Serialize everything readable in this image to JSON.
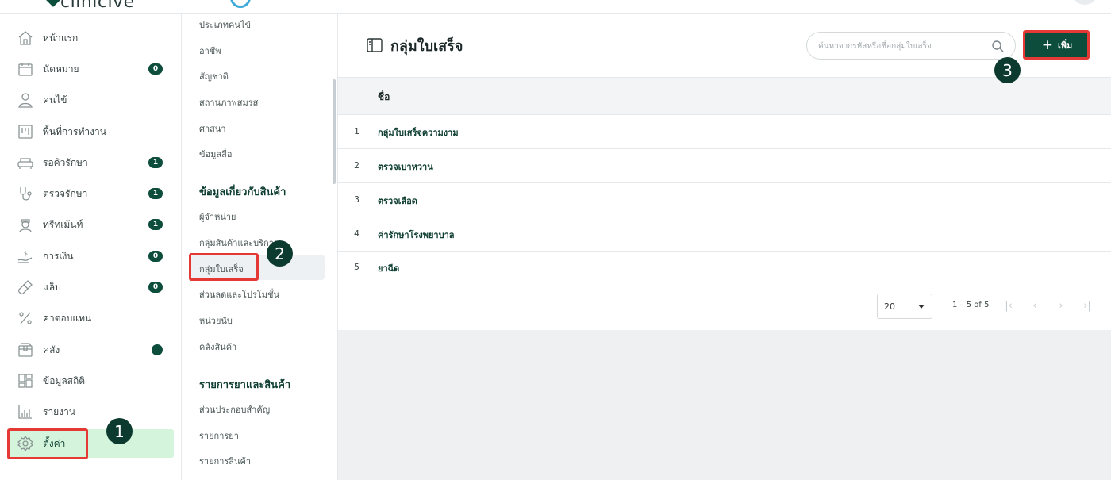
{
  "app": {
    "logo_text": "clinicive"
  },
  "sidebar": {
    "items": [
      {
        "label": "หน้าแรก",
        "icon": "home-icon"
      },
      {
        "label": "นัดหมาย",
        "icon": "calendar-icon",
        "badge": "0"
      },
      {
        "label": "คนไข้",
        "icon": "user-icon"
      },
      {
        "label": "พื้นที่การทำงาน",
        "icon": "board-icon"
      },
      {
        "label": "รอคิวรักษา",
        "icon": "sofa-icon",
        "badge": "1"
      },
      {
        "label": "ตรวจรักษา",
        "icon": "stethoscope-icon",
        "badge": "1"
      },
      {
        "label": "ทรีทเม้นท์",
        "icon": "nurse-icon",
        "badge": "1"
      },
      {
        "label": "การเงิน",
        "icon": "money-hand-icon",
        "badge": "0"
      },
      {
        "label": "แล็บ",
        "icon": "test-tube-icon",
        "badge": "0"
      },
      {
        "label": "ค่าตอบแทน",
        "icon": "percent-icon"
      },
      {
        "label": "คลัง",
        "icon": "box-icon",
        "dot": true
      },
      {
        "label": "ข้อมูลสถิติ",
        "icon": "dashboard-icon"
      },
      {
        "label": "รายงาน",
        "icon": "bar-chart-icon"
      },
      {
        "label": "ตั้งค่า",
        "icon": "gear-icon",
        "active": true
      }
    ]
  },
  "submenu": {
    "items_top": [
      "ประเภทคนไข้",
      "อาชีพ",
      "สัญชาติ",
      "สถานภาพสมรส",
      "ศาสนา",
      "ข้อมูลสื่อ"
    ],
    "section_product": "ข้อมูลเกี่ยวกับสินค้า",
    "items_product": [
      "ผู้จำหน่าย",
      "กลุ่มสินค้าและบริการ",
      "กลุ่มใบเสร็จ",
      "ส่วนลดและโปรโมชั่น",
      "หน่วยนับ",
      "คลังสินค้า"
    ],
    "section_drug": "รายการยาและสินค้า",
    "items_drug": [
      "ส่วนประกอบสำคัญ",
      "รายการยา",
      "รายการสินค้า"
    ],
    "active": "กลุ่มใบเสร็จ"
  },
  "main": {
    "title": "กลุ่มใบเสร็จ",
    "search_placeholder": "ค้นหาจากรหัสหรือชื่อกลุ่มใบเสร็จ",
    "add_label": "เพิ่ม",
    "table": {
      "column_name": "ชื่อ",
      "rows": [
        {
          "num": "1",
          "name": "กลุ่มใบเสร็จความงาม"
        },
        {
          "num": "2",
          "name": "ตรวจเบาหวาน"
        },
        {
          "num": "3",
          "name": "ตรวจเลือด"
        },
        {
          "num": "4",
          "name": "ค่ารักษาโรงพยาบาล"
        },
        {
          "num": "5",
          "name": "ยาฉีด"
        }
      ]
    },
    "pagination": {
      "page_size": "20",
      "range": "1 – 5 of 5"
    }
  },
  "annotations": {
    "step1": "1",
    "step2": "2",
    "step3": "3",
    "highlight_color": "#e53935"
  },
  "colors": {
    "primary": "#0d4d3c",
    "active_bg": "#d4f5dc"
  }
}
